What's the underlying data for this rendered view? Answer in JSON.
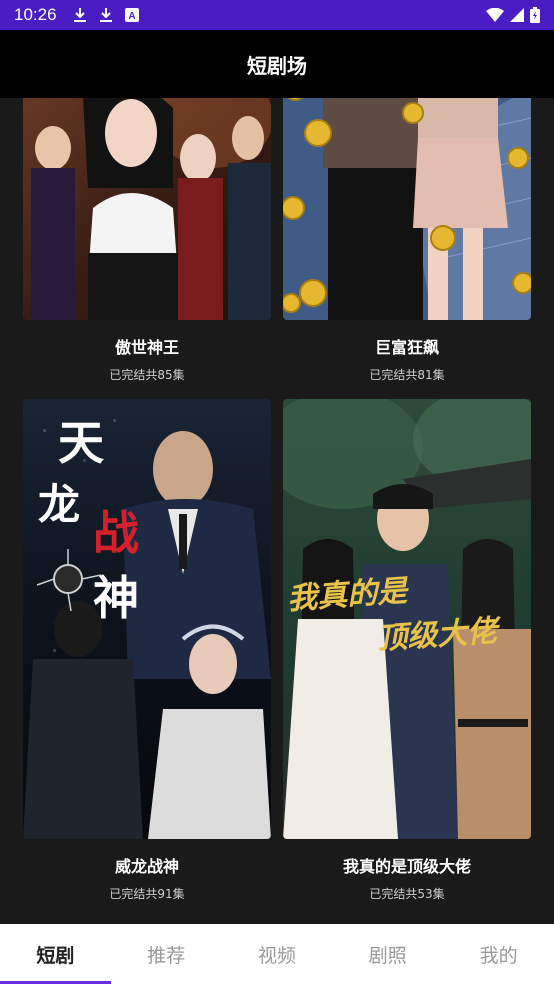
{
  "status_bar": {
    "time": "10:26",
    "left_icons": [
      "download-icon",
      "download-icon",
      "a-app-icon"
    ],
    "right_icons": [
      "wifi-icon",
      "signal-icon",
      "battery-icon"
    ],
    "color": "#4a1cc4"
  },
  "app_bar": {
    "title": "短剧场"
  },
  "dramas": [
    {
      "title": "傲世神王",
      "episodes": "已完结共85集"
    },
    {
      "title": "巨富狂飙",
      "episodes": "已完结共81集"
    },
    {
      "title": "威龙战神",
      "episodes": "已完结共91集",
      "poster_text": [
        "天",
        "龙",
        "战",
        "神"
      ]
    },
    {
      "title": "我真的是顶级大佬",
      "episodes": "已完结共53集",
      "poster_text": [
        "我真的是",
        "顶级大佬"
      ]
    }
  ],
  "bottom_nav": {
    "items": [
      {
        "label": "短剧",
        "active": true
      },
      {
        "label": "推荐",
        "active": false
      },
      {
        "label": "视频",
        "active": false
      },
      {
        "label": "剧照",
        "active": false
      },
      {
        "label": "我的",
        "active": false
      }
    ],
    "accent": "#6b2be0"
  }
}
